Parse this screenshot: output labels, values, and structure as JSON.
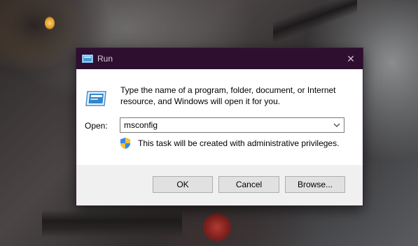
{
  "window": {
    "title": "Run",
    "close_glyph": "✕"
  },
  "dialog": {
    "description": "Type the name of a program, folder, document, or Internet resource, and Windows will open it for you.",
    "open_label": "Open:",
    "open_value": "msconfig",
    "admin_note": "This task will be created with administrative privileges."
  },
  "buttons": {
    "ok": "OK",
    "cancel": "Cancel",
    "browse": "Browse..."
  },
  "icons": {
    "title": "run-icon",
    "main": "run-program-icon",
    "dropdown": "chevron-down-icon",
    "shield": "uac-shield-icon"
  },
  "colors": {
    "titlebar": "#2e0f2f",
    "footer": "#f0f0f0",
    "button": "#e1e1e1"
  }
}
